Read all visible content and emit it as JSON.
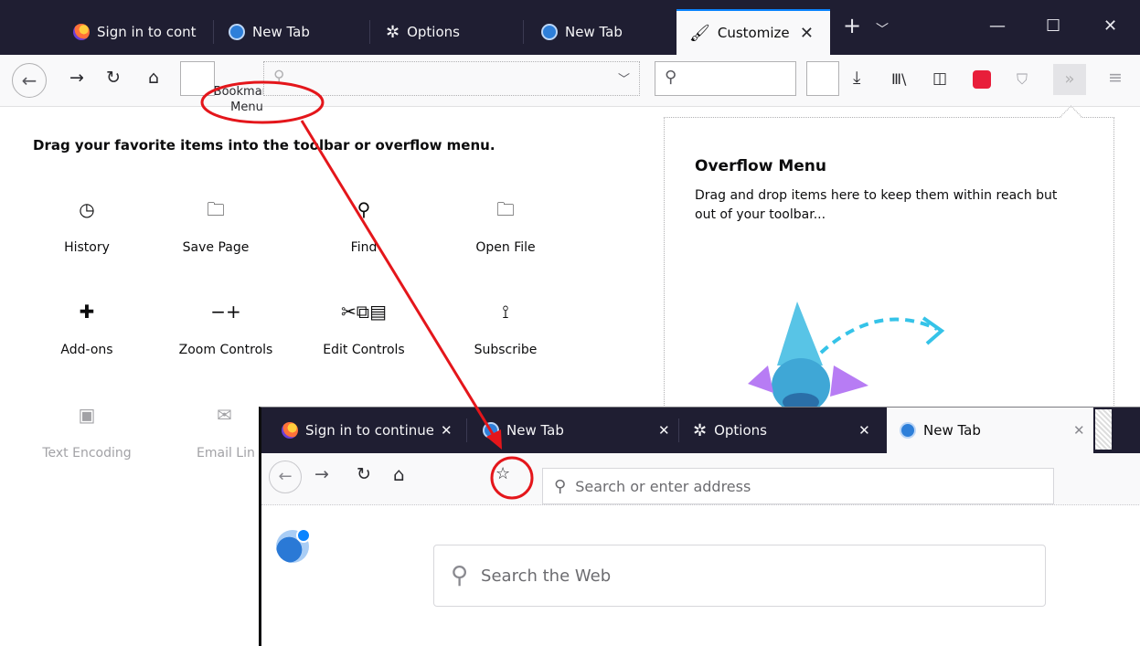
{
  "main_window": {
    "tabs": [
      {
        "title": "Sign in to cont",
        "icon": "firefox-icon"
      },
      {
        "title": "New Tab",
        "icon": "globe-icon"
      },
      {
        "title": "Options",
        "icon": "gear-icon"
      },
      {
        "title": "New Tab",
        "icon": "globe-icon"
      },
      {
        "title": "Customize",
        "icon": "brush-icon",
        "selected": true
      }
    ],
    "new_tab_symbol": "+",
    "bookmarks_menu_label": "Bookmarks Menu",
    "drag_hint": "Drag your favorite items into the toolbar or overflow menu.",
    "palette": [
      {
        "label": "History",
        "icon": "clock-icon"
      },
      {
        "label": "Save Page",
        "icon": "save-page-icon"
      },
      {
        "label": "Find",
        "icon": "search-icon"
      },
      {
        "label": "Open File",
        "icon": "open-file-icon"
      },
      {
        "label": "Add-ons",
        "icon": "puzzle-icon"
      },
      {
        "label": "Zoom Controls",
        "icon": "zoom-icon"
      },
      {
        "label": "Edit Controls",
        "icon": "edit-controls-icon"
      },
      {
        "label": "Subscribe",
        "icon": "rss-icon"
      },
      {
        "label": "Text Encoding",
        "icon": "text-encoding-icon"
      },
      {
        "label": "Email Lin",
        "icon": "email-icon"
      }
    ],
    "overflow_menu": {
      "title": "Overflow Menu",
      "description": "Drag and drop items here to keep them within reach but out of your toolbar..."
    }
  },
  "inset_window": {
    "tabs": [
      {
        "title": "Sign in to continue",
        "icon": "firefox-icon"
      },
      {
        "title": "New Tab",
        "icon": "globe-icon"
      },
      {
        "title": "Options",
        "icon": "gear-icon"
      },
      {
        "title": "New Tab",
        "icon": "globe-icon",
        "selected": true
      }
    ],
    "address_placeholder": "Search or enter address",
    "search_placeholder": "Search the Web"
  },
  "colors": {
    "annotation": "#e4161b",
    "titlebar": "#1f1e32",
    "accent": "#0a84ff"
  }
}
